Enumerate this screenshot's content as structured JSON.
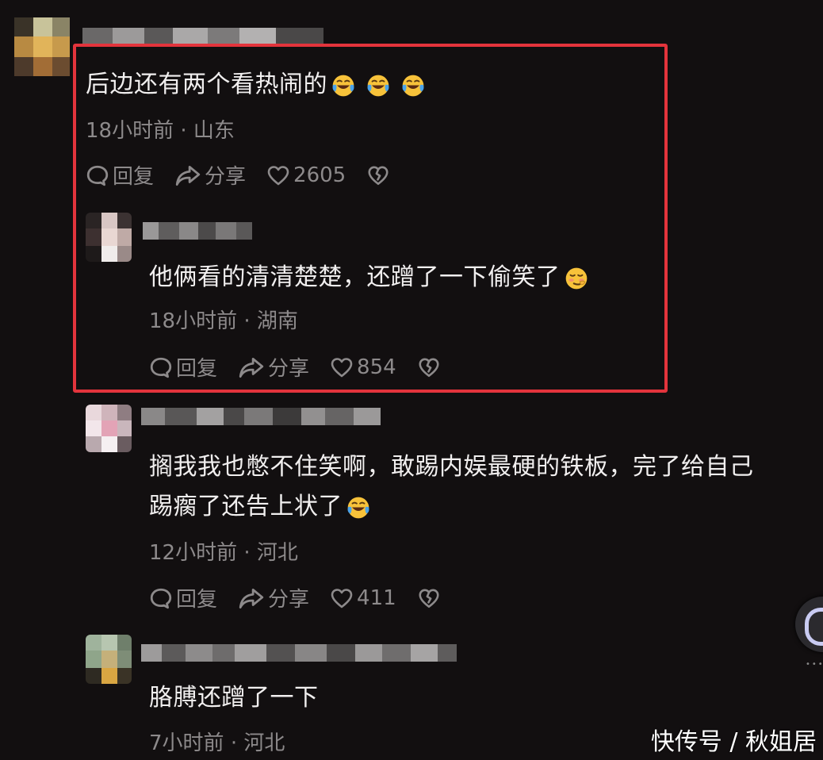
{
  "comments": [
    {
      "text": "后边还有两个看热闹的",
      "emojis": [
        "laugh-cry-emoji",
        "laugh-cry-emoji",
        "laugh-cry-emoji"
      ],
      "time": "18小时前",
      "location": "山东",
      "reply_label": "回复",
      "share_label": "分享",
      "likes": "2605"
    },
    {
      "text": "他俩看的清清楚楚，还蹭了一下偷笑了",
      "emojis": [
        "snicker-emoji"
      ],
      "time": "18小时前",
      "location": "湖南",
      "reply_label": "回复",
      "share_label": "分享",
      "likes": "854"
    },
    {
      "text_line1": "搁我我也憋不住笑啊，敢踢内娱最硬的铁板，完了给自己",
      "text_line2": "踢瘸了还告上状了",
      "emojis": [
        "laugh-cry-emoji"
      ],
      "time": "12小时前",
      "location": "河北",
      "reply_label": "回复",
      "share_label": "分享",
      "likes": "411"
    },
    {
      "text": "胳膊还蹭了一下",
      "time": "7小时前",
      "location": "河北"
    }
  ],
  "separator": "·",
  "watermark": "快传号 / 秋姐居",
  "colors": {
    "background": "#120f10",
    "highlight_border": "#e3343c",
    "meta_text": "#8d8a8b",
    "body_text": "#f1efef"
  }
}
